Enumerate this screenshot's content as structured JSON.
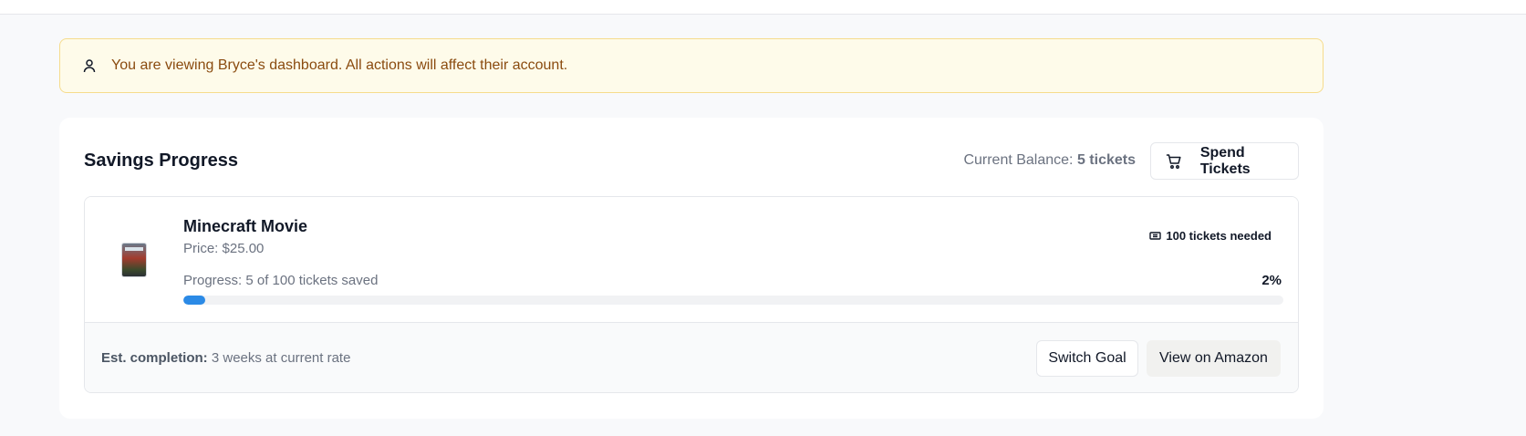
{
  "notice": {
    "icon": "user-icon",
    "text": "You are viewing Bryce's dashboard. All actions will affect their account."
  },
  "savings": {
    "title": "Savings Progress",
    "balance_label": "Current Balance:",
    "balance_value": "5 tickets",
    "spend_button": {
      "icon": "cart-icon",
      "label": "Spend Tickets"
    }
  },
  "goal": {
    "image_alt": "Minecraft Movie cover",
    "name": "Minecraft Movie",
    "price": "Price: $25.00",
    "needed": {
      "icon": "ticket-icon",
      "text": "100 tickets needed"
    },
    "progress_text": "Progress: 5 of 100 tickets saved",
    "progress_percent_text": "2%",
    "progress_fraction": 0.02,
    "est_label": "Est. completion:",
    "est_value": "3 weeks at current rate",
    "switch_button": "Switch Goal",
    "amazon_button": "View on Amazon"
  },
  "colors": {
    "progress_fill": "#2b8ae6",
    "notice_bg": "#fefbea",
    "notice_text": "#8a4b0f"
  }
}
